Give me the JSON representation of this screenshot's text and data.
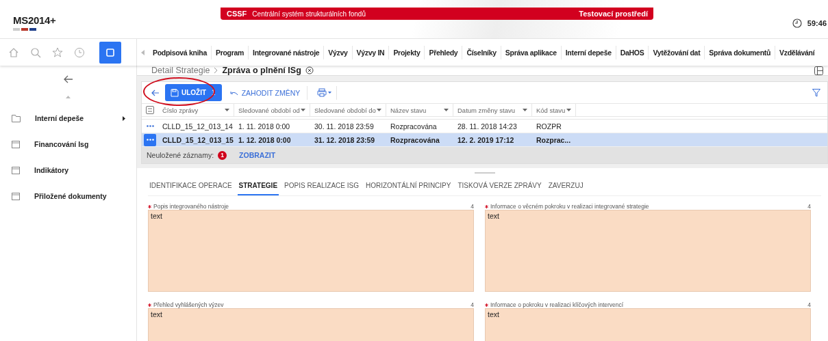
{
  "header": {
    "logo": "MS2014+",
    "banner_code": "CSSF",
    "banner_title": "Centrální systém strukturálních fondů",
    "banner_env": "Testovací prostředí",
    "timer": "59:46"
  },
  "toolbar_icons": [
    {
      "kind": "home",
      "selected": false
    },
    {
      "kind": "search",
      "selected": false
    },
    {
      "kind": "star",
      "selected": false
    },
    {
      "kind": "history",
      "selected": false
    },
    {
      "kind": "window",
      "selected": true
    }
  ],
  "nav": [
    "Podpisová kniha",
    "Program",
    "Integrované nástroje",
    "Výzvy",
    "Výzvy IN",
    "Projekty",
    "Přehledy",
    "Číselníky",
    "Správa aplikace",
    "Interní depeše",
    "DaHOS",
    "Vytěžování dat",
    "Správa dokumentů",
    "Vzdělávání"
  ],
  "sidebar": {
    "items": [
      {
        "label": "Interní depeše",
        "kind": "folder",
        "submenu": true
      },
      {
        "label": "Financování Isg",
        "kind": "form",
        "submenu": false
      },
      {
        "label": "Indikátory",
        "kind": "form",
        "submenu": false
      },
      {
        "label": "Přiložené dokumenty",
        "kind": "form",
        "submenu": false
      }
    ]
  },
  "breadcrumb": {
    "parent": "Detail Strategie",
    "current": "Zpráva o plnění ISg"
  },
  "grid": {
    "save_label": "ULOŽIT",
    "save_count": "1",
    "discard_label": "ZAHODIT ZMĚNY",
    "columns": [
      "Číslo zprávy",
      "Sledované období od",
      "Sledované období do",
      "Název stavu",
      "Datum změny stavu",
      "Kód stavu"
    ],
    "rows": [
      {
        "selected": false,
        "cells": [
          "CLLD_15_12_013_14",
          "1. 11. 2018 0:00",
          "30. 11. 2018 23:59",
          "Rozpracována",
          "28. 11. 2018 14:23",
          "ROZPR"
        ]
      },
      {
        "selected": true,
        "cells": [
          "CLLD_15_12_013_15",
          "1. 12. 2018 0:00",
          "31. 12. 2018 23:59",
          "Rozpracována",
          "12. 2. 2019 17:12",
          "Rozprac..."
        ]
      }
    ],
    "unsaved_label": "Neuložené záznamy:",
    "unsaved_count": "1",
    "show_label": "ZOBRAZIT"
  },
  "tabs": [
    {
      "label": "IDENTIFIKACE OPERACE",
      "selected": false
    },
    {
      "label": "STRATEGIE",
      "selected": true
    },
    {
      "label": "POPIS REALIZACE ISG",
      "selected": false
    },
    {
      "label": "HORIZONTÁLNÍ PRINCIPY",
      "selected": false
    },
    {
      "label": "TISKOVÁ VERZE ZPRÁVY",
      "selected": false
    },
    {
      "label": "ZAVERZUJ",
      "selected": false
    }
  ],
  "fields": [
    {
      "label": "Popis integrovaného nástroje",
      "required": true,
      "count": "4",
      "value": "text"
    },
    {
      "label": "Informace o věcném pokroku v realizaci integrované strategie",
      "required": true,
      "count": "4",
      "value": "text"
    },
    {
      "label": "Přehled vyhlášených výzev",
      "required": true,
      "count": "4",
      "value": "text"
    },
    {
      "label": "Informace o pokroku v realizaci klíčových intervencí",
      "required": true,
      "count": "4",
      "value": "text"
    }
  ]
}
